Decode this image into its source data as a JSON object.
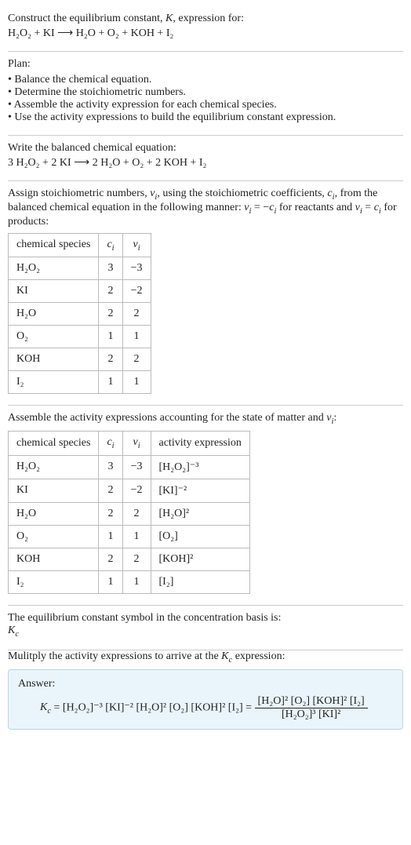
{
  "s1": {
    "line1": "Construct the equilibrium constant, K, expression for:",
    "line2": "H₂O₂ + KI ⟶ H₂O + O₂ + KOH + I₂"
  },
  "s2": {
    "heading": "Plan:",
    "items": [
      "Balance the chemical equation.",
      "Determine the stoichiometric numbers.",
      "Assemble the activity expression for each chemical species.",
      "Use the activity expressions to build the equilibrium constant expression."
    ]
  },
  "s3": {
    "line1": "Write the balanced chemical equation:",
    "line2": "3 H₂O₂ + 2 KI ⟶ 2 H₂O + O₂ + 2 KOH + I₂"
  },
  "s4": {
    "intro1": "Assign stoichiometric numbers, νᵢ, using the stoichiometric coefficients, cᵢ, from the balanced chemical equation in the following manner: νᵢ = −cᵢ for reactants and νᵢ = cᵢ for products:",
    "headers": {
      "a": "chemical species",
      "b": "cᵢ",
      "c": "νᵢ"
    },
    "rows": [
      {
        "a": "H₂O₂",
        "b": "3",
        "c": "−3"
      },
      {
        "a": "KI",
        "b": "2",
        "c": "−2"
      },
      {
        "a": "H₂O",
        "b": "2",
        "c": "2"
      },
      {
        "a": "O₂",
        "b": "1",
        "c": "1"
      },
      {
        "a": "KOH",
        "b": "2",
        "c": "2"
      },
      {
        "a": "I₂",
        "b": "1",
        "c": "1"
      }
    ]
  },
  "s5": {
    "intro": "Assemble the activity expressions accounting for the state of matter and νᵢ:",
    "headers": {
      "a": "chemical species",
      "b": "cᵢ",
      "c": "νᵢ",
      "d": "activity expression"
    },
    "rows": [
      {
        "a": "H₂O₂",
        "b": "3",
        "c": "−3",
        "d": "[H₂O₂]⁻³"
      },
      {
        "a": "KI",
        "b": "2",
        "c": "−2",
        "d": "[KI]⁻²"
      },
      {
        "a": "H₂O",
        "b": "2",
        "c": "2",
        "d": "[H₂O]²"
      },
      {
        "a": "O₂",
        "b": "1",
        "c": "1",
        "d": "[O₂]"
      },
      {
        "a": "KOH",
        "b": "2",
        "c": "2",
        "d": "[KOH]²"
      },
      {
        "a": "I₂",
        "b": "1",
        "c": "1",
        "d": "[I₂]"
      }
    ]
  },
  "s6": {
    "line1": "The equilibrium constant symbol in the concentration basis is:",
    "line2": "K꜀"
  },
  "s7": {
    "intro": "Mulitply the activity expressions to arrive at the K꜀ expression:",
    "answer_label": "Answer:",
    "lhs": "K꜀ = [H₂O₂]⁻³ [KI]⁻² [H₂O]² [O₂] [KOH]² [I₂] = ",
    "num": "[H₂O]² [O₂] [KOH]² [I₂]",
    "den": "[H₂O₂]³ [KI]²"
  }
}
